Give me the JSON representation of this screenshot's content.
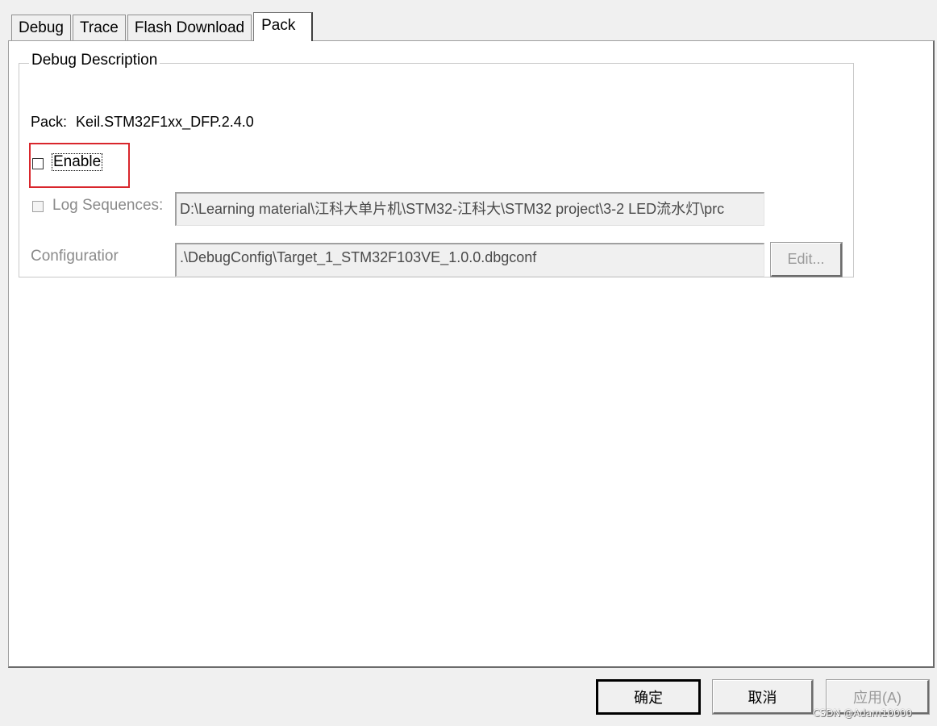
{
  "tabs": [
    {
      "label": "Debug",
      "active": false
    },
    {
      "label": "Trace",
      "active": false
    },
    {
      "label": "Flash Download",
      "active": false
    },
    {
      "label": "Pack",
      "active": true
    }
  ],
  "group": {
    "title": "Debug Description",
    "pack_label": "Pack:",
    "pack_value": "Keil.STM32F1xx_DFP.2.4.0",
    "enable": {
      "label": "Enable",
      "checked": false,
      "highlighted": true
    },
    "log_sequences": {
      "label": "Log Sequences:",
      "checked": false,
      "enabled": false,
      "value": "D:\\Learning material\\江科大单片机\\STM32-江科大\\STM32 project\\3-2 LED流水灯\\prc"
    },
    "configuration": {
      "label": "Configuratior",
      "value": ".\\DebugConfig\\Target_1_STM32F103VE_1.0.0.dbgconf",
      "edit_label": "Edit..."
    }
  },
  "footer": {
    "ok_label": "确定",
    "cancel_label": "取消",
    "apply_label": "应用(A)"
  },
  "watermark": "CSDN @Adam10000",
  "colors": {
    "highlight_border": "#d9262c",
    "panel_bg": "#ffffff",
    "window_bg": "#f0f0f0"
  }
}
